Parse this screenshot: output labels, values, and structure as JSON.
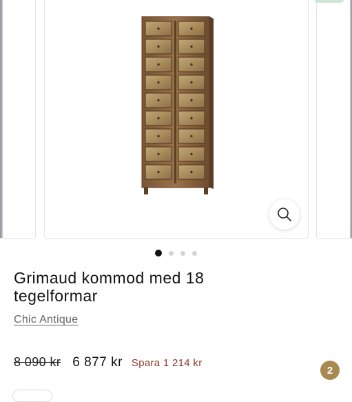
{
  "gallery": {
    "slide_count": 4,
    "active_index": 0,
    "image_alt": "Grimaud kommod med 18 tegelformar",
    "zoom_icon": "magnifier-icon"
  },
  "product": {
    "title": "Grimaud kommod med 18 tegelformar",
    "vendor": "Chic Antique",
    "compare_price": "8 090 kr",
    "price": "6 877 kr",
    "saving": "Spara 1 214 kr"
  },
  "cart": {
    "count": "2"
  },
  "colors": {
    "saving_text": "#8a3a2e",
    "badge_bg": "#a8894f",
    "active_dot": "#111111",
    "inactive_dot": "#d3d3d3"
  }
}
